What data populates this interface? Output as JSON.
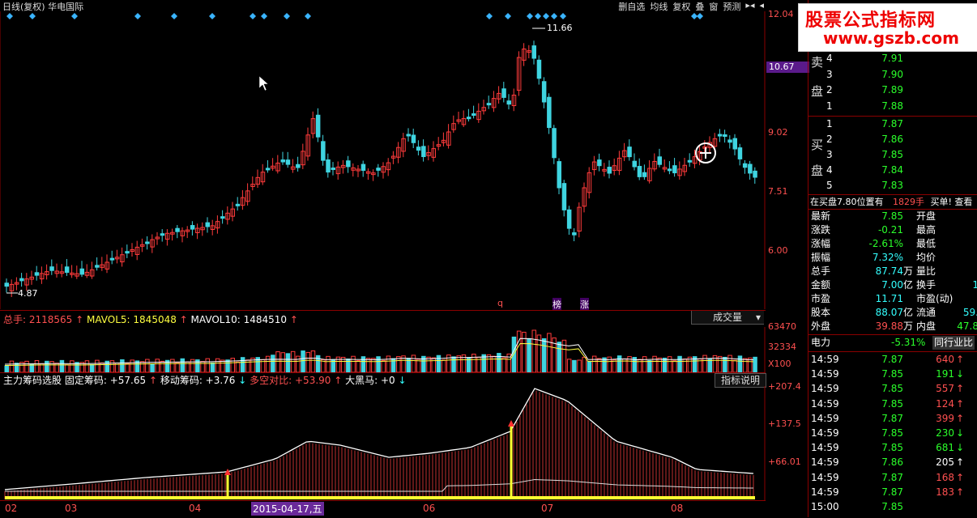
{
  "top": {
    "title": "日线(复权)  华电国际",
    "toolbar": [
      "删自选",
      "均线",
      "复权",
      "叠",
      "窗",
      "预测",
      "▸◂",
      "◂"
    ]
  },
  "main_chart": {
    "price_axis": [
      "12.04",
      "10.67",
      "9.02",
      "7.51",
      "6.00"
    ],
    "current_price_tag": "10.67",
    "high_label": "11.66",
    "low_label": "4.87",
    "markers": [
      "q",
      "榜",
      "涨"
    ],
    "colors": {
      "up": "#ff3b3b",
      "down": "#3fd4e0",
      "bg": "#000000",
      "grid": "#8b0000"
    }
  },
  "volume": {
    "label_total": "总手: 2118565",
    "label_ma5": "MAVOL5: 1845048",
    "label_ma10": "MAVOL10: 1484510",
    "selector": "成交量",
    "axis": [
      "63470",
      "32334",
      "X100"
    ]
  },
  "indicator": {
    "name": "主力筹码选股",
    "fixed": "固定筹码: +57.65",
    "moving": "移动筹码: +3.76",
    "longshort": "多空对比: +53.90",
    "horse": "大黑马: +0",
    "explain": "指标说明",
    "axis": [
      "+207.4",
      "+137.5",
      "+66.01"
    ]
  },
  "date_axis": [
    "02",
    "03",
    "04",
    "2015-04-17,五",
    "06",
    "07",
    "08"
  ],
  "logo": {
    "line1": "股票公式指标网",
    "line2": "www.gszb.com"
  },
  "orderbook": {
    "sell_label": [
      "卖",
      "盘"
    ],
    "buy_label": [
      "买",
      "盘"
    ],
    "sell": [
      {
        "lvl": "4",
        "price": "7.91"
      },
      {
        "lvl": "3",
        "price": "7.90"
      },
      {
        "lvl": "2",
        "price": "7.89"
      },
      {
        "lvl": "1",
        "price": "7.88"
      }
    ],
    "buy": [
      {
        "lvl": "1",
        "price": "7.87"
      },
      {
        "lvl": "2",
        "price": "7.86"
      },
      {
        "lvl": "3",
        "price": "7.85"
      },
      {
        "lvl": "4",
        "price": "7.84"
      },
      {
        "lvl": "5",
        "price": "7.83"
      }
    ],
    "notice_left": "在买盘7.80位置有",
    "notice_qty": "1829手",
    "notice_right": "买单! 查看"
  },
  "quote": [
    {
      "l": "最新",
      "v": "7.85",
      "u": "",
      "r": "开盘",
      "rv": ""
    },
    {
      "l": "涨跌",
      "v": "-0.21",
      "u": "",
      "r": "最高",
      "rv": ""
    },
    {
      "l": "涨幅",
      "v": "-2.61%",
      "u": "",
      "r": "最低",
      "rv": ""
    },
    {
      "l": "振幅",
      "v": "7.32%",
      "u": "",
      "r": "均价",
      "rv": ""
    },
    {
      "l": "总手",
      "v": "87.74",
      "u": "万",
      "r": "量比",
      "rv": ""
    },
    {
      "l": "金额",
      "v": "7.00",
      "u": "亿",
      "r": "换手",
      "rv": "1"
    },
    {
      "l": "市盈",
      "v": "11.71",
      "u": "",
      "r": "市盈(动)",
      "rv": ""
    },
    {
      "l": "股本",
      "v": "88.07",
      "u": "亿",
      "r": "流通",
      "rv": "59."
    },
    {
      "l": "外盘",
      "v": "39.88",
      "u": "万",
      "r": "内盘",
      "rv": "47.8"
    }
  ],
  "sector": {
    "name": "电力",
    "change": "-5.31%",
    "link": "同行业比"
  },
  "ticks": [
    {
      "t": "14:59",
      "p": "7.87",
      "q": "640",
      "d": "up"
    },
    {
      "t": "14:59",
      "p": "7.85",
      "q": "191",
      "d": "down"
    },
    {
      "t": "14:59",
      "p": "7.85",
      "q": "557",
      "d": "up"
    },
    {
      "t": "14:59",
      "p": "7.85",
      "q": "124",
      "d": "up"
    },
    {
      "t": "14:59",
      "p": "7.87",
      "q": "399",
      "d": "up"
    },
    {
      "t": "14:59",
      "p": "7.85",
      "q": "230",
      "d": "down"
    },
    {
      "t": "14:59",
      "p": "7.85",
      "q": "681",
      "d": "down"
    },
    {
      "t": "14:59",
      "p": "7.86",
      "q": "205",
      "d": "neutral"
    },
    {
      "t": "14:59",
      "p": "7.87",
      "q": "168",
      "d": "up"
    },
    {
      "t": "14:59",
      "p": "7.87",
      "q": "183",
      "d": "up"
    },
    {
      "t": "15:00",
      "p": "7.85",
      "q": "",
      "d": ""
    }
  ]
}
